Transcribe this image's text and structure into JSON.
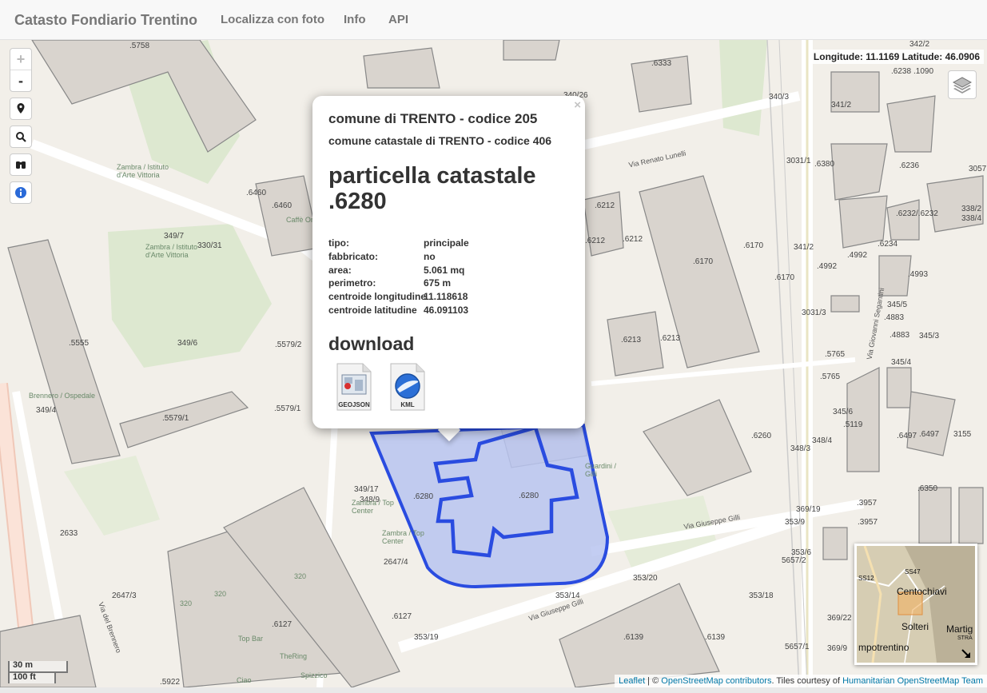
{
  "navbar": {
    "brand": "Catasto Fondiario Trentino",
    "links": [
      "Localizza con foto",
      "Info",
      "API"
    ]
  },
  "controls": {
    "zoom_in": "+",
    "zoom_out": "-"
  },
  "coordinates": "Longitude: 11.1169 Latitude: 46.0906",
  "popup": {
    "close": "×",
    "comune": "comune di TRENTO - codice 205",
    "comune_catastale": "comune catastale di TRENTO - codice 406",
    "particella": "particella catastale .6280",
    "attributes": [
      {
        "key": "tipo:",
        "value": "principale"
      },
      {
        "key": "fabbricato:",
        "value": "no"
      },
      {
        "key": "area:",
        "value": "5.061 mq"
      },
      {
        "key": "perimetro:",
        "value": "675 m"
      },
      {
        "key": "centroide longitudine",
        "value": "11.118618"
      },
      {
        "key": "centroide latitudine",
        "value": "46.091103"
      }
    ],
    "download_title": "download",
    "downloads": [
      {
        "label": "GEOJSON",
        "icon": "geojson-file-icon"
      },
      {
        "label": "KML",
        "icon": "google-earth-kml-icon"
      }
    ]
  },
  "map_labels": [
    ".5758",
    ".6333",
    "342/2",
    ".6238",
    ".1090",
    "341/2",
    "340/3",
    "340/26",
    ".6460",
    ".6460",
    "Caffè Orso",
    "349/7",
    "330/31",
    "Zambra / Istituto d'Arte Vittoria",
    "Zambra / Istituto d'Arte Vittoria",
    ".6212",
    ".6212",
    ".6212",
    ".6170",
    ".6170",
    ".6170",
    "3031/1",
    ".6380",
    ".6236",
    "3057",
    "338/2",
    "338/4",
    ".6232/.6232",
    ".6234",
    "341/2",
    ".4992",
    ".4992",
    ".4993",
    "3031/3",
    "345/5",
    ".4883",
    ".4883",
    "345/3",
    "345/4",
    ".5555",
    "349/6",
    ".5579/2",
    ".6213",
    ".6213",
    ".5765",
    ".5765",
    "345/6",
    ".5119",
    ".6497",
    ".6497",
    "3155",
    ".5579/1",
    ".5579/1",
    "349/4",
    "Brennero / Ospedale",
    ".6260",
    "348/4",
    "348/3",
    ".6350",
    ".3957",
    ".3957",
    "Guardini / Gilli",
    ".6280",
    ".6280",
    "349/17",
    "348/9",
    "Zambra / Top Center",
    "Zambra / Top Center",
    "2647/4",
    "2633",
    "2647/3",
    "Via del Brennero",
    "Via Giuseppe Gilli",
    "Via Giuseppe Gilli",
    "Via Renato Lunelli",
    "Via Giovanni Segantini",
    "353/20",
    "353/14",
    "353/18",
    "353/19",
    ".6127",
    ".6127",
    ".6139",
    ".6139",
    "353/9",
    "369/19",
    "369/22",
    "369/9",
    "353/6",
    "5657/2",
    "5657/1",
    ".5922",
    "320",
    "320",
    "320",
    "Top Bar",
    "TheRing",
    "Spizzico",
    "Ciao"
  ],
  "scale": {
    "metric": "30 m",
    "imperial": "100 ft"
  },
  "minimap": {
    "labels": [
      "Centochiavi",
      "Solteri",
      "Martig",
      "mpotrentino",
      "SS12",
      "SS47",
      "STRA"
    ]
  },
  "attribution": {
    "leaflet": "Leaflet",
    "sep": " | © ",
    "osm": "OpenStreetMap contributors",
    "tiles": ". Tiles courtesy of ",
    "hot": "Humanitarian OpenStreetMap Team"
  },
  "colors": {
    "parcel_fill": "#b8c4f0",
    "parcel_stroke": "#2a4ce0",
    "building": "#d9d4ce",
    "green": "#dde8d0",
    "road": "#ffffff"
  }
}
